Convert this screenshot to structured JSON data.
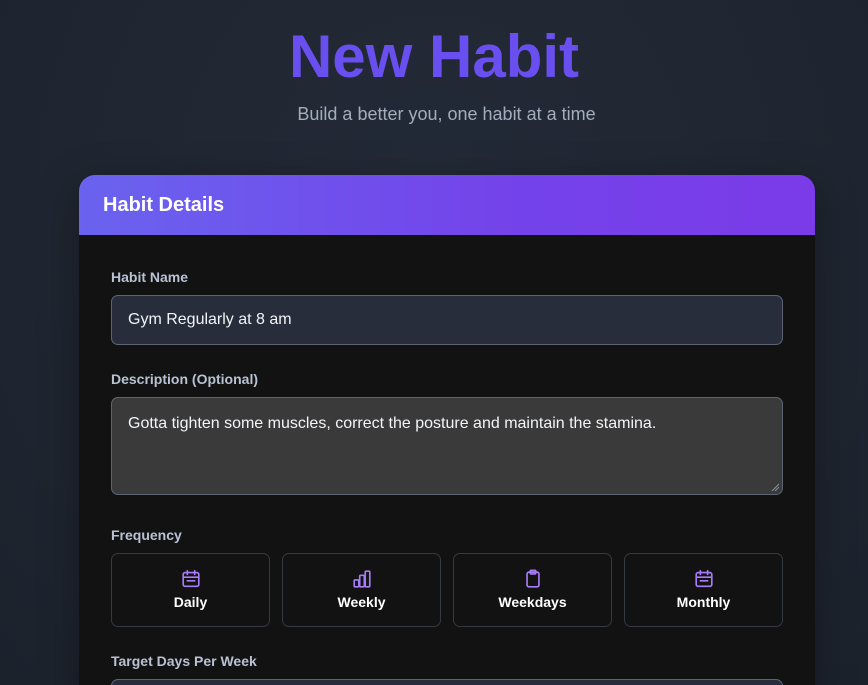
{
  "header": {
    "title": "New Habit",
    "subtitle": "Build a better you, one habit at a time"
  },
  "card": {
    "title": "Habit Details",
    "habit_name": {
      "label": "Habit Name",
      "value": "Gym Regularly at 8 am"
    },
    "description": {
      "label": "Description (Optional)",
      "value": "Gotta tighten some muscles, correct the posture and maintain the stamina."
    },
    "frequency": {
      "label": "Frequency",
      "options": [
        {
          "label": "Daily",
          "icon": "calendar-icon"
        },
        {
          "label": "Weekly",
          "icon": "bar-chart-icon"
        },
        {
          "label": "Weekdays",
          "icon": "clipboard-icon"
        },
        {
          "label": "Monthly",
          "icon": "calendar-icon"
        }
      ]
    },
    "target_days": {
      "label": "Target Days Per Week"
    }
  },
  "colors": {
    "accent": "#6a4ff0",
    "header_gradient_start": "#6a63ef",
    "header_gradient_end": "#7b3be8",
    "icon": "#a77cf6"
  }
}
